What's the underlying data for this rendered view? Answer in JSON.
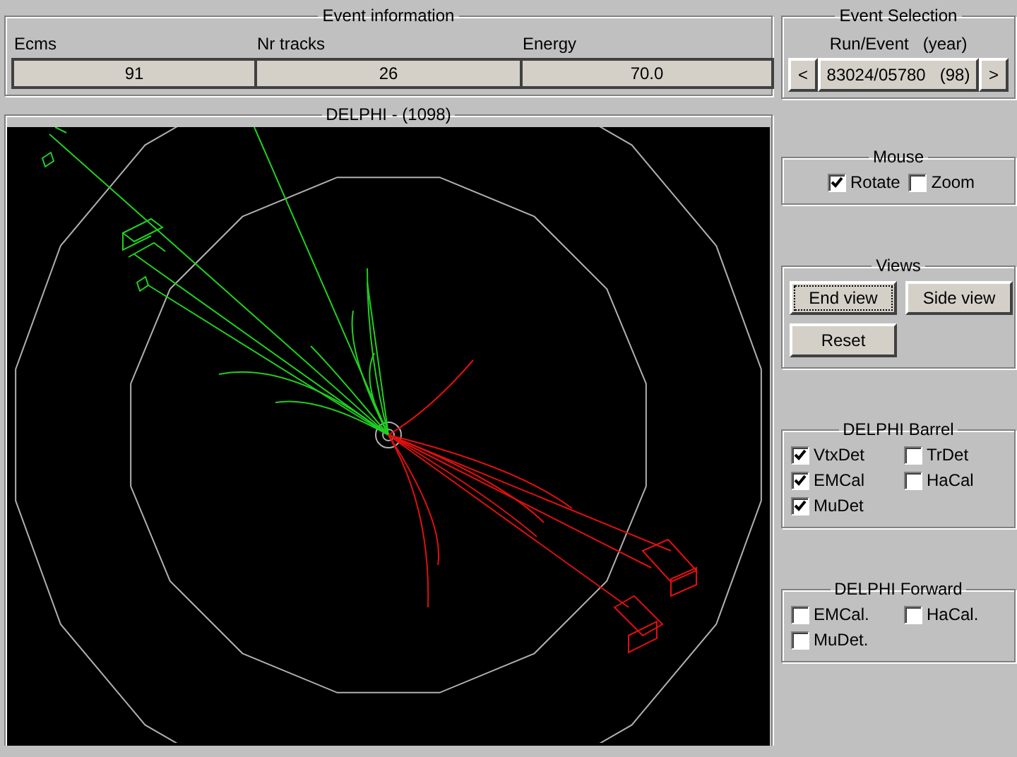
{
  "event_information": {
    "title": "Event information",
    "fields": [
      {
        "label": "Ecms",
        "value": "91"
      },
      {
        "label": "Nr tracks",
        "value": "26"
      },
      {
        "label": "Energy",
        "value": "70.0"
      }
    ]
  },
  "event_selection": {
    "title": "Event Selection",
    "caption": "Run/Event   (year)",
    "prev_button": "<",
    "event": "83024/05780   (98)",
    "next_button": ">"
  },
  "display": {
    "title": "DELPHI - (1098)"
  },
  "mouse": {
    "title": "Mouse",
    "options": [
      {
        "label": "Rotate",
        "checked": true
      },
      {
        "label": "Zoom",
        "checked": false
      }
    ]
  },
  "views": {
    "title": "Views",
    "buttons": [
      {
        "label": "End view",
        "focused": true
      },
      {
        "label": "Side view",
        "focused": false
      },
      {
        "label": "Reset",
        "focused": false
      }
    ]
  },
  "barrel": {
    "title": "DELPHI Barrel",
    "options": [
      {
        "label": "VtxDet",
        "checked": true
      },
      {
        "label": "TrDet",
        "checked": false
      },
      {
        "label": "EMCal",
        "checked": true
      },
      {
        "label": "HaCal",
        "checked": false
      },
      {
        "label": "MuDet",
        "checked": true
      }
    ]
  },
  "forward": {
    "title": "DELPHI Forward",
    "options": [
      {
        "label": "EMCal.",
        "checked": false
      },
      {
        "label": "HaCal.",
        "checked": false
      },
      {
        "label": "MuDet.",
        "checked": false
      }
    ]
  }
}
